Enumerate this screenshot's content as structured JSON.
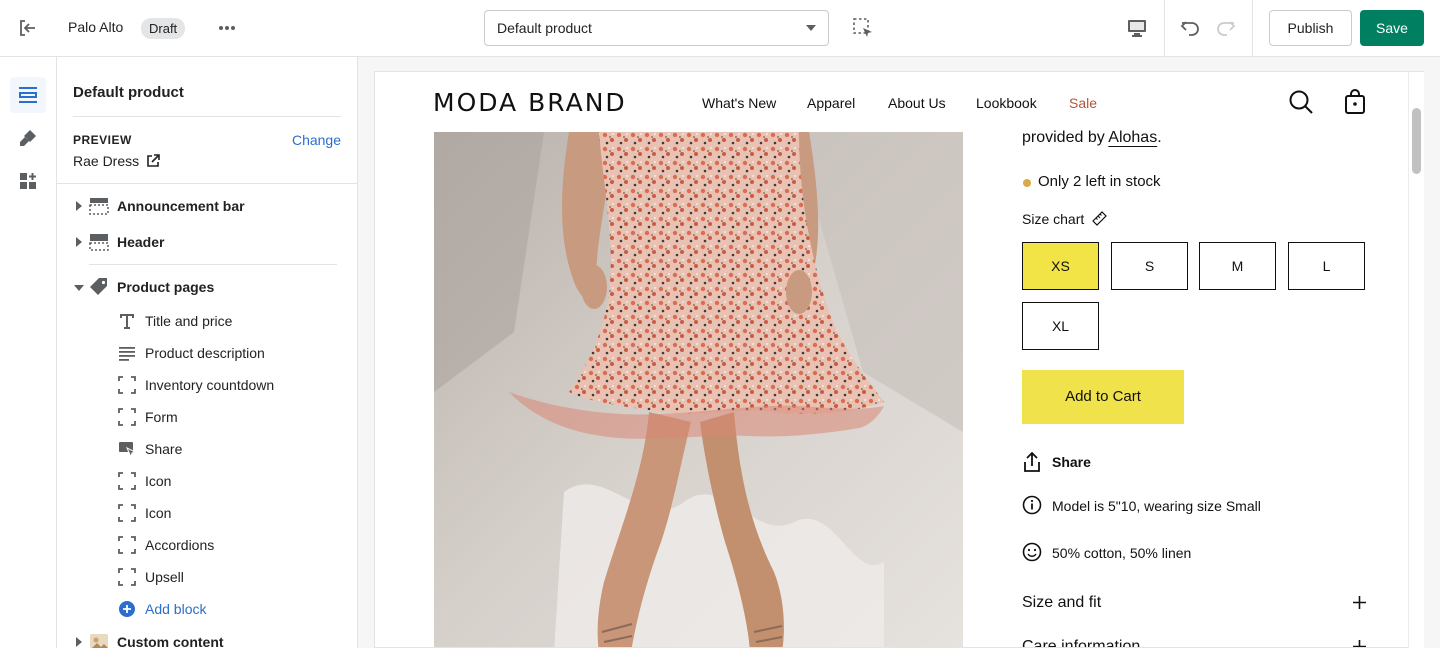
{
  "topbar": {
    "store_name": "Palo Alto",
    "status_badge": "Draft",
    "template_select": "Default product",
    "publish_label": "Publish",
    "save_label": "Save"
  },
  "rail": {
    "items": [
      {
        "icon": "sections-icon",
        "active": true
      },
      {
        "icon": "theme-settings-icon",
        "active": false
      },
      {
        "icon": "app-embeds-icon",
        "active": false
      }
    ]
  },
  "panel": {
    "title": "Default product",
    "preview_label": "PREVIEW",
    "preview_change": "Change",
    "preview_value": "Rae Dress",
    "sections": [
      {
        "label": "Announcement bar",
        "icon": "announcement-bar-icon",
        "expanded": false
      },
      {
        "label": "Header",
        "icon": "header-icon",
        "expanded": false
      },
      {
        "label": "Product pages",
        "icon": "tag-icon",
        "expanded": true
      }
    ],
    "blocks": [
      {
        "label": "Title and price",
        "icon": "text-icon"
      },
      {
        "label": "Product description",
        "icon": "paragraph-icon"
      },
      {
        "label": "Inventory countdown",
        "icon": "block-icon"
      },
      {
        "label": "Form",
        "icon": "block-icon"
      },
      {
        "label": "Share",
        "icon": "share-icon"
      },
      {
        "label": "Icon",
        "icon": "block-icon"
      },
      {
        "label": "Icon",
        "icon": "block-icon"
      },
      {
        "label": "Accordions",
        "icon": "block-icon"
      },
      {
        "label": "Upsell",
        "icon": "block-icon"
      }
    ],
    "add_block": "Add block",
    "custom_content": "Custom content"
  },
  "store": {
    "brand": "MODA BRAND",
    "nav": [
      "What's New",
      "Apparel",
      "About Us",
      "Lookbook",
      "Sale"
    ],
    "provided_prefix": "provided by ",
    "provided_link": "Alohas",
    "provided_suffix": ".",
    "stock": "Only 2 left in stock",
    "size_chart": "Size chart",
    "sizes": [
      "XS",
      "S",
      "M",
      "L",
      "XL"
    ],
    "selected_size": "XS",
    "add_to_cart": "Add to Cart",
    "share": "Share",
    "feature_model": "Model is 5\"10, wearing size Small",
    "feature_fabric": "50% cotton, 50% linen",
    "accordions": [
      "Size and fit",
      "Care information"
    ]
  },
  "colors": {
    "save_button": "#008060",
    "accent_blue": "#2c6ecb",
    "size_selected": "#f2e347",
    "add_to_cart": "#efe24a",
    "sale_link": "#b4543c",
    "stock_dot": "#d9a94c"
  }
}
